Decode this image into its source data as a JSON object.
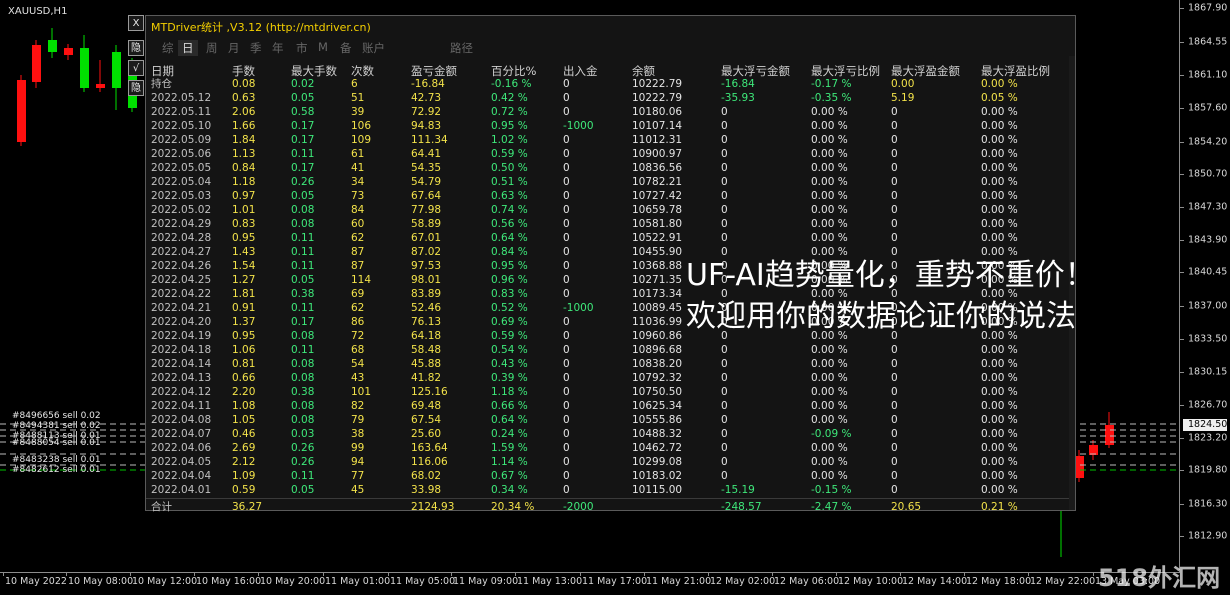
{
  "chart": {
    "symbol": "XAUUSD,H1",
    "current_price": "1824.50",
    "price_ticks": [
      "1867.90",
      "1864.55",
      "1861.10",
      "1857.60",
      "1854.20",
      "1850.70",
      "1847.30",
      "1843.90",
      "1840.45",
      "1837.00",
      "1833.50",
      "1830.15",
      "1826.70",
      "1823.20",
      "1819.80",
      "1816.30",
      "1812.90"
    ],
    "time_ticks": [
      "10 May 2022",
      "10 May 08:00",
      "10 May 12:00",
      "10 May 16:00",
      "10 May 20:00",
      "11 May 01:00",
      "11 May 05:00",
      "11 May 09:00",
      "11 May 13:00",
      "11 May 17:00",
      "11 May 21:00",
      "12 May 02:00",
      "12 May 06:00",
      "12 May 10:00",
      "12 May 14:00",
      "12 May 18:00",
      "12 May 22:00",
      "13 May 03:00"
    ],
    "orders": [
      "#8496656 sell 0.02",
      "#8494381 sell 0.02",
      "#8488113 sell 0.01",
      "#8488054 sell 0.01",
      "#8483238 sell 0.01",
      "#8482612 sell 0.01"
    ],
    "side_buttons": [
      "X",
      "隐",
      "√",
      "隐"
    ],
    "colors": {
      "bull": "#00e000",
      "bear": "#ff1010",
      "background": "#000000"
    }
  },
  "panel": {
    "title": "MTDriver统计 ,V3.12 (http://mtdriver.cn)",
    "tabs": [
      "综",
      "日",
      "周",
      "月",
      "季",
      "年",
      "市",
      "M",
      "备",
      "账户",
      "路径"
    ],
    "active_tab": "日",
    "headers": [
      "日期",
      "手数",
      "最大手数",
      "次数",
      "盈亏金额",
      "百分比%",
      "出入金",
      "余额",
      "最大浮亏金额",
      "最大浮亏比例",
      "最大浮盈金额",
      "最大浮盈比例"
    ],
    "rows": [
      [
        "持仓",
        "0.08",
        "0.02",
        "6",
        "-16.84",
        "-0.16 %",
        "0",
        "10222.79",
        "-16.84",
        "-0.17 %",
        "0.00",
        "0.00 %"
      ],
      [
        "2022.05.12",
        "0.63",
        "0.05",
        "51",
        "42.73",
        "0.42 %",
        "0",
        "10222.79",
        "-35.93",
        "-0.35 %",
        "5.19",
        "0.05 %"
      ],
      [
        "2022.05.11",
        "2.06",
        "0.58",
        "39",
        "72.92",
        "0.72 %",
        "0",
        "10180.06",
        "0",
        "0.00 %",
        "0",
        "0.00 %"
      ],
      [
        "2022.05.10",
        "1.66",
        "0.17",
        "106",
        "94.83",
        "0.95 %",
        "-1000",
        "10107.14",
        "0",
        "0.00 %",
        "0",
        "0.00 %"
      ],
      [
        "2022.05.09",
        "1.84",
        "0.17",
        "109",
        "111.34",
        "1.02 %",
        "0",
        "11012.31",
        "0",
        "0.00 %",
        "0",
        "0.00 %"
      ],
      [
        "2022.05.06",
        "1.13",
        "0.11",
        "61",
        "64.41",
        "0.59 %",
        "0",
        "10900.97",
        "0",
        "0.00 %",
        "0",
        "0.00 %"
      ],
      [
        "2022.05.05",
        "0.84",
        "0.17",
        "41",
        "54.35",
        "0.50 %",
        "0",
        "10836.56",
        "0",
        "0.00 %",
        "0",
        "0.00 %"
      ],
      [
        "2022.05.04",
        "1.18",
        "0.26",
        "34",
        "54.79",
        "0.51 %",
        "0",
        "10782.21",
        "0",
        "0.00 %",
        "0",
        "0.00 %"
      ],
      [
        "2022.05.03",
        "0.97",
        "0.05",
        "73",
        "67.64",
        "0.63 %",
        "0",
        "10727.42",
        "0",
        "0.00 %",
        "0",
        "0.00 %"
      ],
      [
        "2022.05.02",
        "1.01",
        "0.08",
        "84",
        "77.98",
        "0.74 %",
        "0",
        "10659.78",
        "0",
        "0.00 %",
        "0",
        "0.00 %"
      ],
      [
        "2022.04.29",
        "0.83",
        "0.08",
        "60",
        "58.89",
        "0.56 %",
        "0",
        "10581.80",
        "0",
        "0.00 %",
        "0",
        "0.00 %"
      ],
      [
        "2022.04.28",
        "0.95",
        "0.11",
        "62",
        "67.01",
        "0.64 %",
        "0",
        "10522.91",
        "0",
        "0.00 %",
        "0",
        "0.00 %"
      ],
      [
        "2022.04.27",
        "1.43",
        "0.11",
        "87",
        "87.02",
        "0.84 %",
        "0",
        "10455.90",
        "0",
        "0.00 %",
        "0",
        "0.00 %"
      ],
      [
        "2022.04.26",
        "1.54",
        "0.11",
        "87",
        "97.53",
        "0.95 %",
        "0",
        "10368.88",
        "0",
        "0.00 %",
        "0",
        "0.00 %"
      ],
      [
        "2022.04.25",
        "1.27",
        "0.05",
        "114",
        "98.01",
        "0.96 %",
        "0",
        "10271.35",
        "0",
        "0.00 %",
        "0",
        "0.00 %"
      ],
      [
        "2022.04.22",
        "1.81",
        "0.38",
        "69",
        "83.89",
        "0.83 %",
        "0",
        "10173.34",
        "0",
        "0.00 %",
        "0",
        "0.00 %"
      ],
      [
        "2022.04.21",
        "0.91",
        "0.11",
        "62",
        "52.46",
        "0.52 %",
        "-1000",
        "10089.45",
        "0",
        "0.00 %",
        "0",
        "0.00 %"
      ],
      [
        "2022.04.20",
        "1.37",
        "0.17",
        "86",
        "76.13",
        "0.69 %",
        "0",
        "11036.99",
        "0",
        "0.00 %",
        "0",
        "0.00 %"
      ],
      [
        "2022.04.19",
        "0.95",
        "0.08",
        "72",
        "64.18",
        "0.59 %",
        "0",
        "10960.86",
        "0",
        "0.00 %",
        "0",
        "0.00 %"
      ],
      [
        "2022.04.18",
        "1.06",
        "0.11",
        "68",
        "58.48",
        "0.54 %",
        "0",
        "10896.68",
        "0",
        "0.00 %",
        "0",
        "0.00 %"
      ],
      [
        "2022.04.14",
        "0.81",
        "0.08",
        "54",
        "45.88",
        "0.43 %",
        "0",
        "10838.20",
        "0",
        "0.00 %",
        "0",
        "0.00 %"
      ],
      [
        "2022.04.13",
        "0.66",
        "0.08",
        "43",
        "41.82",
        "0.39 %",
        "0",
        "10792.32",
        "0",
        "0.00 %",
        "0",
        "0.00 %"
      ],
      [
        "2022.04.12",
        "2.20",
        "0.38",
        "101",
        "125.16",
        "1.18 %",
        "0",
        "10750.50",
        "0",
        "0.00 %",
        "0",
        "0.00 %"
      ],
      [
        "2022.04.11",
        "1.08",
        "0.08",
        "82",
        "69.48",
        "0.66 %",
        "0",
        "10625.34",
        "0",
        "0.00 %",
        "0",
        "0.00 %"
      ],
      [
        "2022.04.08",
        "1.05",
        "0.08",
        "79",
        "67.54",
        "0.64 %",
        "0",
        "10555.86",
        "0",
        "0.00 %",
        "0",
        "0.00 %"
      ],
      [
        "2022.04.07",
        "0.46",
        "0.03",
        "38",
        "25.60",
        "0.24 %",
        "0",
        "10488.32",
        "0",
        "-0.09 %",
        "0",
        "0.00 %"
      ],
      [
        "2022.04.06",
        "2.69",
        "0.26",
        "99",
        "163.64",
        "1.59 %",
        "0",
        "10462.72",
        "0",
        "0.00 %",
        "0",
        "0.00 %"
      ],
      [
        "2022.04.05",
        "2.12",
        "0.26",
        "94",
        "116.06",
        "1.14 %",
        "0",
        "10299.08",
        "0",
        "0.00 %",
        "0",
        "0.00 %"
      ],
      [
        "2022.04.04",
        "1.09",
        "0.11",
        "77",
        "68.02",
        "0.67 %",
        "0",
        "10183.02",
        "0",
        "0.00 %",
        "0",
        "0.00 %"
      ],
      [
        "2022.04.01",
        "0.59",
        "0.05",
        "45",
        "33.98",
        "0.34 %",
        "0",
        "10115.00",
        "-15.19",
        "-0.15 %",
        "0",
        "0.00 %"
      ]
    ],
    "total": [
      "合计",
      "36.27",
      "",
      "",
      "2124.93",
      "20.34 %",
      "-2000",
      "",
      "-248.57",
      "-2.47 %",
      "20.65",
      "0.21 %"
    ]
  },
  "overlay": {
    "line1": "UF-AI趋势量化，重势不重价！",
    "line2": "欢迎用你的数据论证你的说法"
  },
  "watermark": "518外汇网"
}
